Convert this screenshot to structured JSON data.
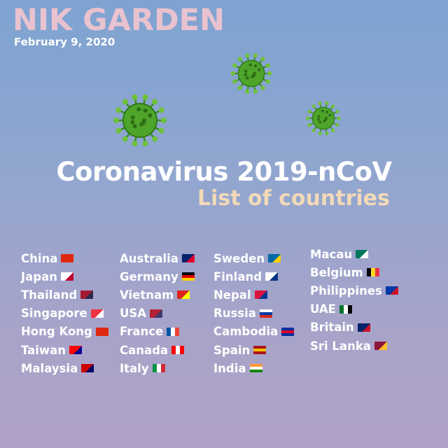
{
  "brand": "NIK GARDEN",
  "date": "February 9, 2020",
  "title": "Coronavirus 2019-nCoV",
  "subtitle": "List of countries",
  "columns": [
    {
      "countries": [
        {
          "name": "China",
          "flag": "china-flag-icon",
          "colors": [
            "#de2910",
            "#de2910"
          ]
        },
        {
          "name": "Japan",
          "flag": "japan-flag-icon",
          "colors": [
            "#ffffff",
            "#bc002d"
          ]
        },
        {
          "name": "Thailand",
          "flag": "thailand-flag-icon",
          "colors": [
            "#a51931",
            "#2d2a4a"
          ]
        },
        {
          "name": "Singapore",
          "flag": "singapore-flag-icon",
          "colors": [
            "#ef3340",
            "#ffffff"
          ]
        },
        {
          "name": "Hong Kong",
          "flag": "hong-kong-flag-icon",
          "colors": [
            "#de2910",
            "#de2910"
          ]
        },
        {
          "name": "Taiwan",
          "flag": "taiwan-flag-icon",
          "colors": [
            "#fe0000",
            "#000095"
          ]
        },
        {
          "name": "Malaysia",
          "flag": "malaysia-flag-icon",
          "colors": [
            "#cc0001",
            "#010066"
          ]
        }
      ]
    },
    {
      "countries": [
        {
          "name": "Australia",
          "flag": "australia-flag-icon",
          "colors": [
            "#012169",
            "#e4002b"
          ]
        },
        {
          "name": "Germany",
          "flag": "germany-flag-icon",
          "colors": [
            "#000000",
            "#dd0000",
            "#ffce00"
          ]
        },
        {
          "name": "Vietnam",
          "flag": "vietnam-flag-icon",
          "colors": [
            "#da251d",
            "#ffff00"
          ]
        },
        {
          "name": "USA",
          "flag": "usa-flag-icon",
          "colors": [
            "#b22234",
            "#3c3b6e"
          ]
        },
        {
          "name": "France",
          "flag": "france-flag-icon",
          "colors": [
            "#0055a4",
            "#ffffff",
            "#ef4135"
          ]
        },
        {
          "name": "Canada",
          "flag": "canada-flag-icon",
          "colors": [
            "#ff0000",
            "#ffffff",
            "#ff0000"
          ]
        },
        {
          "name": "Italy",
          "flag": "italy-flag-icon",
          "colors": [
            "#009246",
            "#ffffff",
            "#ce2b37"
          ]
        }
      ]
    },
    {
      "countries": [
        {
          "name": "Sweden",
          "flag": "sweden-flag-icon",
          "colors": [
            "#006aa7",
            "#fecc00"
          ]
        },
        {
          "name": "Finland",
          "flag": "finland-flag-icon",
          "colors": [
            "#ffffff",
            "#003580"
          ]
        },
        {
          "name": "Nepal",
          "flag": "nepal-flag-icon",
          "colors": [
            "#dc143c",
            "#003893"
          ]
        },
        {
          "name": "Russia",
          "flag": "russia-flag-icon",
          "colors": [
            "#ffffff",
            "#0039a6",
            "#d52b1e"
          ]
        },
        {
          "name": "Cambodia",
          "flag": "cambodia-flag-icon",
          "colors": [
            "#032ea1",
            "#e00025",
            "#032ea1"
          ]
        },
        {
          "name": "Spain",
          "flag": "spain-flag-icon",
          "colors": [
            "#aa151b",
            "#f1bf00",
            "#aa151b"
          ]
        },
        {
          "name": "India",
          "flag": "india-flag-icon",
          "colors": [
            "#ff9933",
            "#ffffff",
            "#138808"
          ]
        }
      ]
    },
    {
      "countries": [
        {
          "name": "Macau",
          "flag": "macau-flag-icon",
          "colors": [
            "#00785e",
            "#ffffff"
          ]
        },
        {
          "name": "Belgium",
          "flag": "belgium-flag-icon",
          "colors": [
            "#000000",
            "#fdda24",
            "#ef3340"
          ]
        },
        {
          "name": "Philippines",
          "flag": "philippines-flag-icon",
          "colors": [
            "#0038a8",
            "#ce1126"
          ]
        },
        {
          "name": "UAE",
          "flag": "uae-flag-icon",
          "colors": [
            "#00732f",
            "#ffffff",
            "#000000"
          ]
        },
        {
          "name": "Britain",
          "flag": "britain-flag-icon",
          "colors": [
            "#012169",
            "#c8102e"
          ]
        },
        {
          "name": "Sri Lanka",
          "flag": "sri-lanka-flag-icon",
          "colors": [
            "#8d153a",
            "#ffbe29"
          ]
        }
      ]
    }
  ],
  "colors": {
    "brand": "#e9c2cf",
    "subtitle": "#f2d9b8",
    "virus": "#4fa52a"
  },
  "virus_icons": [
    "virus-icon",
    "virus-icon",
    "virus-icon"
  ]
}
